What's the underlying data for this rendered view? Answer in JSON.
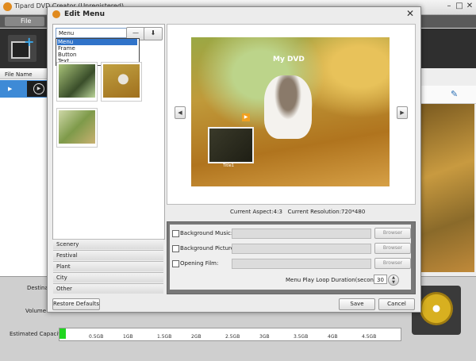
{
  "app": {
    "title": "Tipard DVD Creator (Unregistered)",
    "menu_file": "File",
    "column_file_name": "File Name",
    "labels": {
      "destination": "Destinati",
      "volume_label": "Volume La",
      "estimated_capacity": "Estimated Capacity:"
    },
    "capacity": {
      "ticks": [
        "0.5GB",
        "1GB",
        "1.5GB",
        "2GB",
        "2.5GB",
        "3GB",
        "3.5GB",
        "4GB",
        "4.5GB"
      ],
      "used_fraction": 0.02
    }
  },
  "dialog": {
    "title": "Edit Menu",
    "template_select": {
      "value": "Menu",
      "options": [
        "Menu",
        "Frame",
        "Button",
        "Text"
      ],
      "selected_index": 0
    },
    "categories": [
      "Scenery",
      "Festival",
      "Plant",
      "City",
      "Other"
    ],
    "preview": {
      "menu_title": "My DVD",
      "title_label": "Title1"
    },
    "current_aspect": "Current Aspect:4:3",
    "current_resolution": "Current Resolution:720*480",
    "options": {
      "background_music": "Background Music:",
      "background_picture": "Background Picture:",
      "opening_film": "Opening Film:",
      "browser_label": "Browser"
    },
    "loop_duration": {
      "label": "Menu Play Loop Duration(seconds):",
      "value": "30"
    },
    "buttons": {
      "restore_defaults": "Restore Defaults",
      "save": "Save",
      "cancel": "Cancel"
    }
  },
  "colors": {
    "selection": "#3073c9",
    "capacity_fill": "#21d621",
    "toolbar": "#2f2f2f"
  }
}
